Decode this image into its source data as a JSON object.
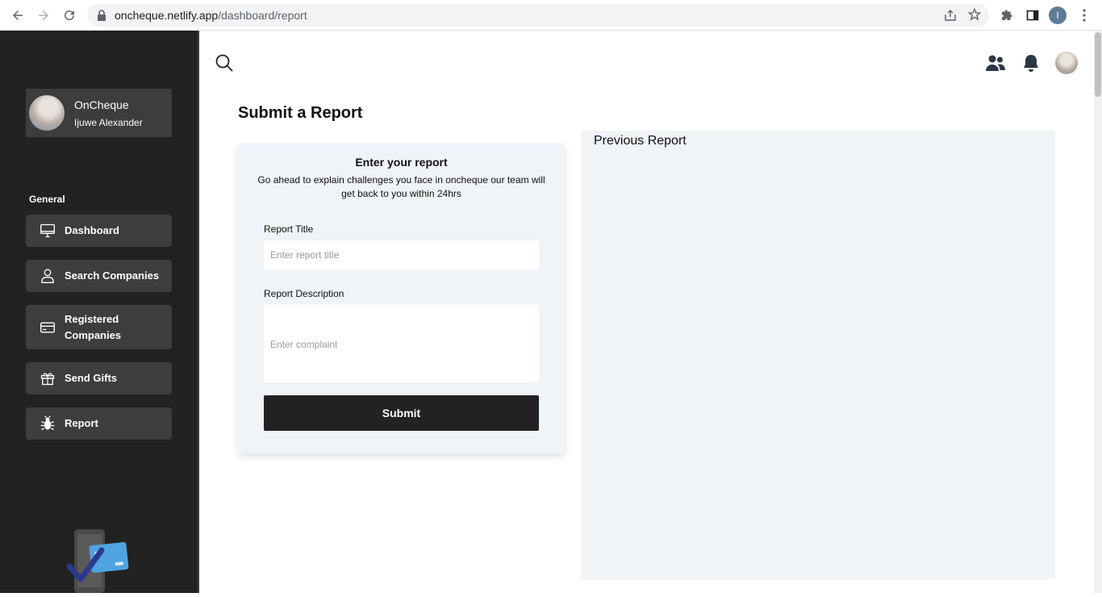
{
  "browser": {
    "url_host": "oncheque.netlify.app",
    "url_path": "/dashboard/report",
    "profile_initial": "I"
  },
  "sidebar": {
    "profile": {
      "name": "OnCheque",
      "username": "Ijuwe Alexander"
    },
    "section_label": "General",
    "items": [
      {
        "label": "Dashboard",
        "icon": "monitor-icon"
      },
      {
        "label": "Search Companies",
        "icon": "user-icon"
      },
      {
        "label": "Registered Companies",
        "icon": "card-icon"
      },
      {
        "label": "Send Gifts",
        "icon": "gift-icon"
      },
      {
        "label": "Report",
        "icon": "bug-icon"
      }
    ]
  },
  "main": {
    "page_title": "Submit a Report",
    "form": {
      "heading": "Enter your report",
      "subtitle": "Go ahead to explain challenges you face in oncheque our team will get back to you within 24hrs",
      "title_label": "Report Title",
      "title_placeholder": "Enter report title",
      "description_label": "Report Description",
      "description_placeholder": "Enter complaint",
      "submit_label": "Submit"
    },
    "previous": {
      "title": "Previous Report"
    }
  },
  "colors": {
    "sidebar_bg": "#222222",
    "nav_item_bg": "#3d3d3d",
    "panel_bg": "#f0f3f8",
    "button_bg": "#222222"
  }
}
